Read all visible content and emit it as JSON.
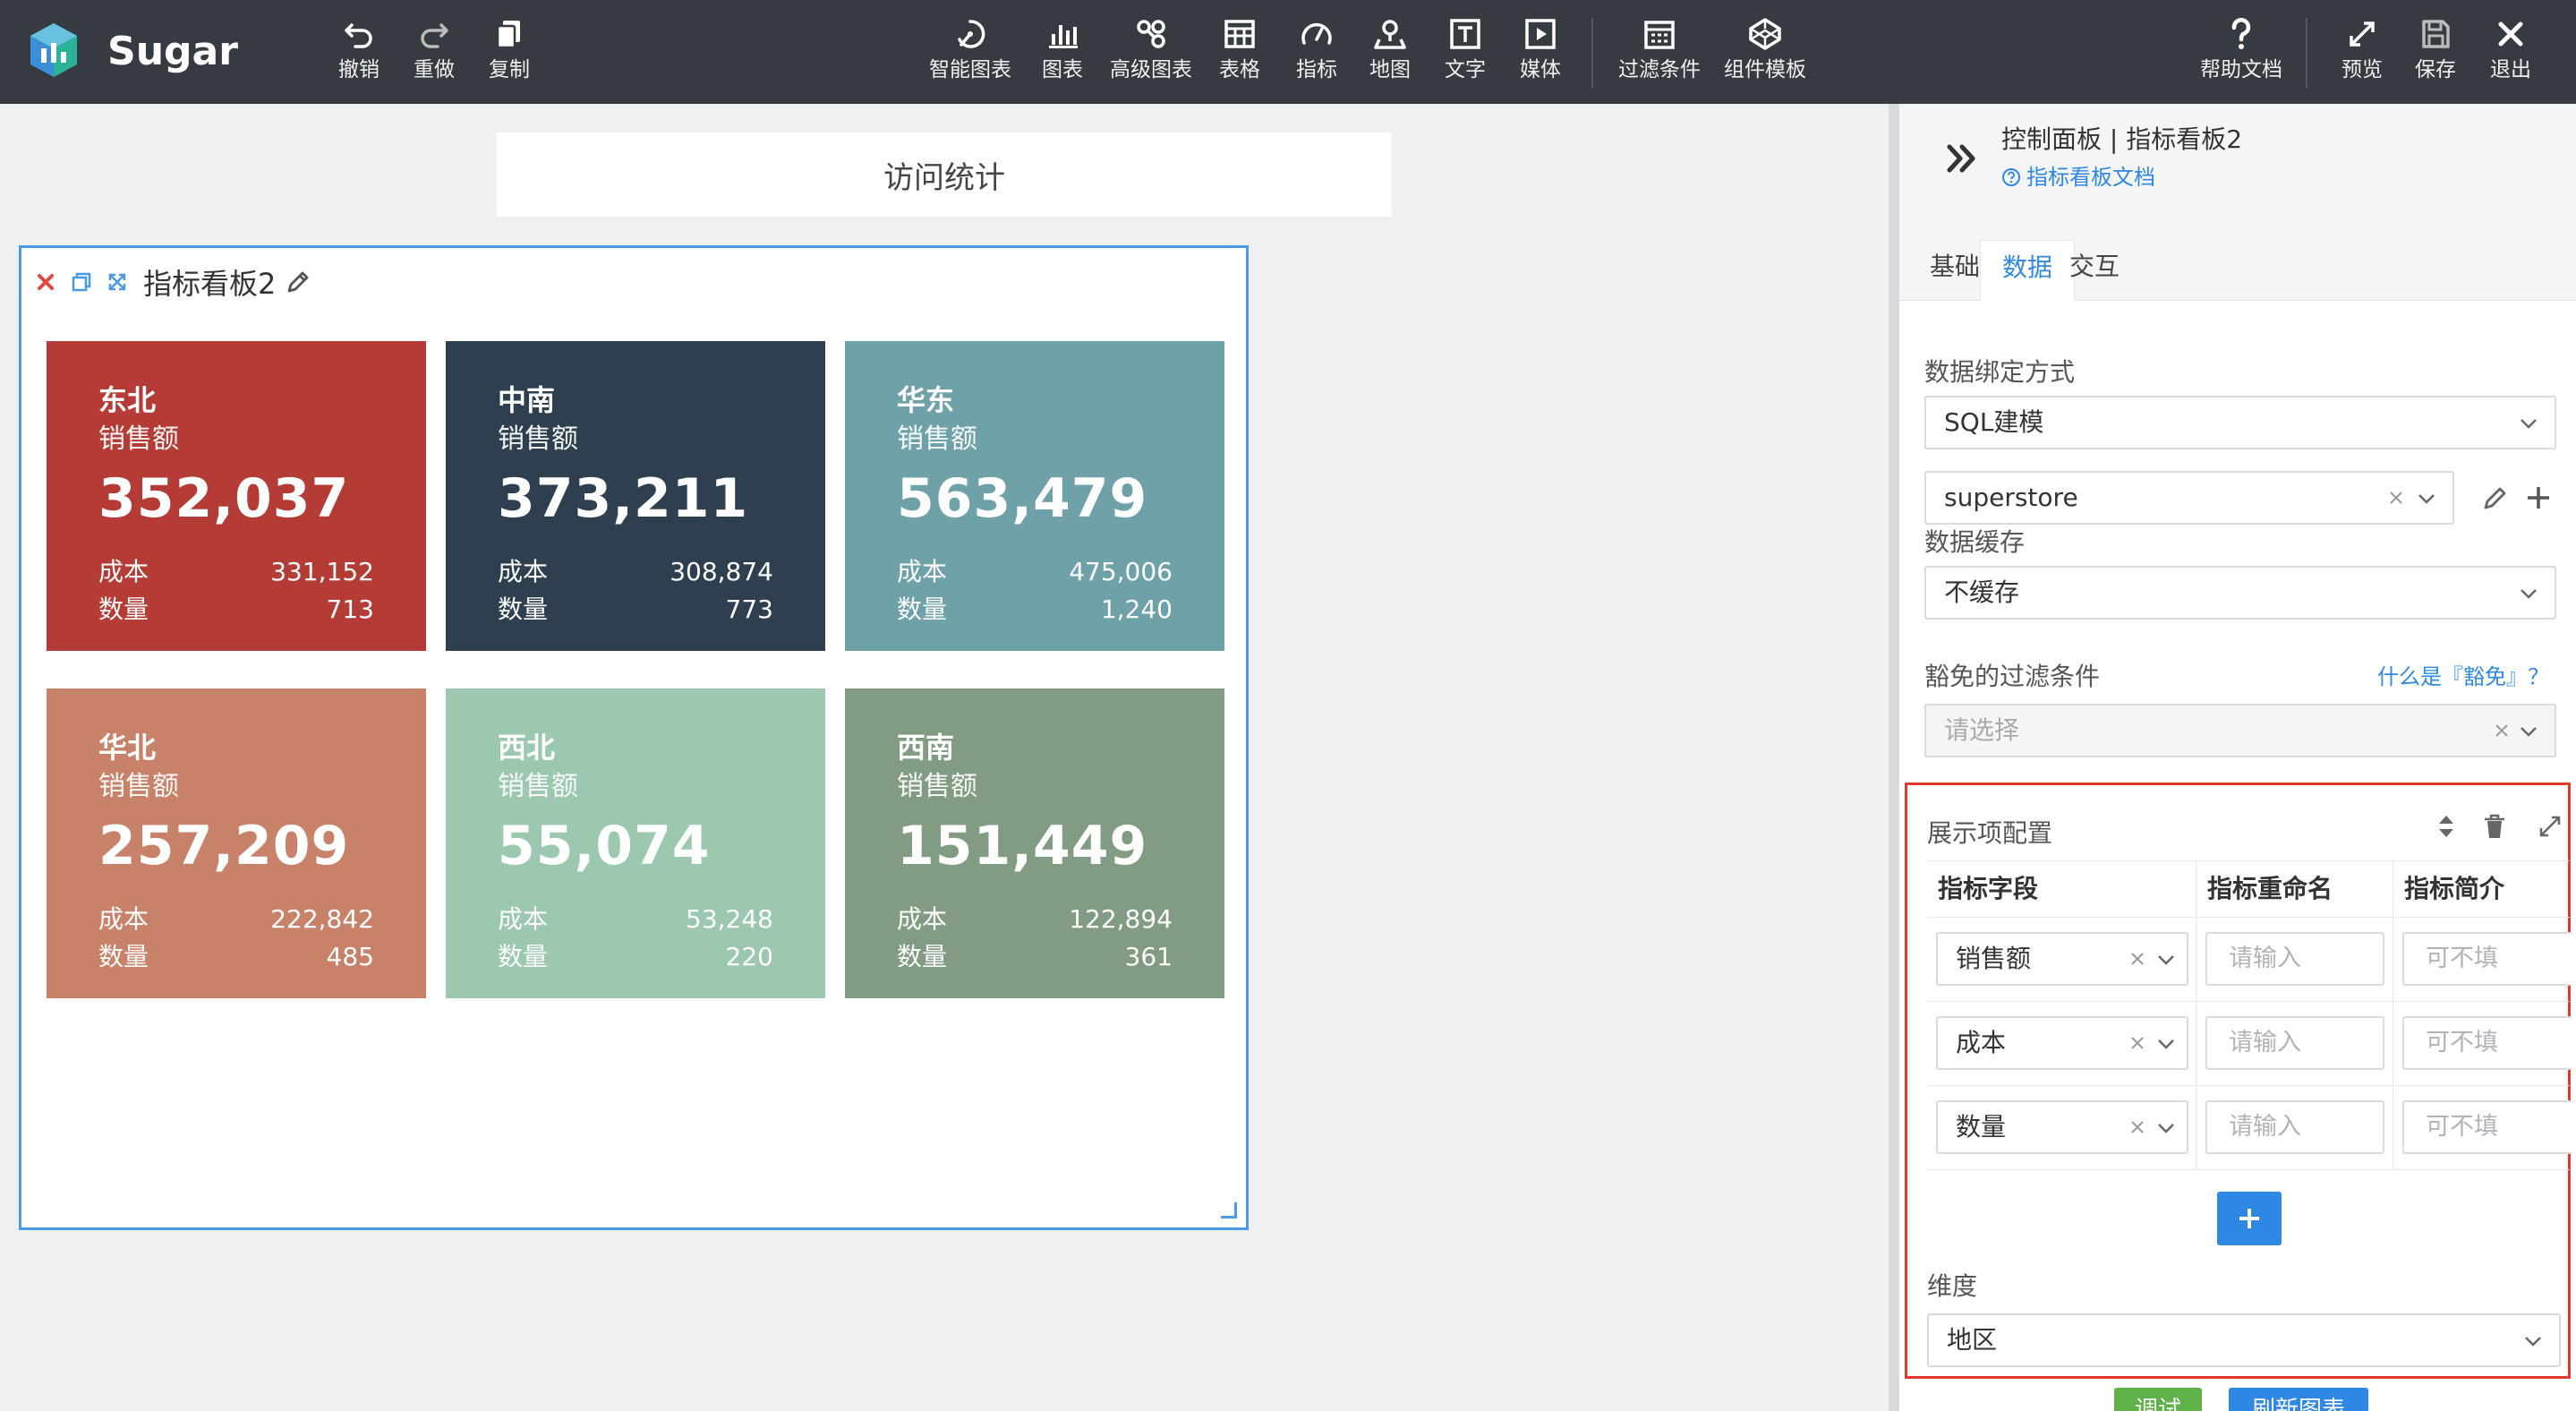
{
  "app": {
    "brand": "Sugar"
  },
  "toolbar": {
    "undo": "撤销",
    "redo": "重做",
    "copy": "复制",
    "smart_chart": "智能图表",
    "chart": "图表",
    "advanced_chart": "高级图表",
    "table": "表格",
    "indicator": "指标",
    "map": "地图",
    "text": "文字",
    "media": "媒体",
    "filter": "过滤条件",
    "component_template": "组件模板",
    "help": "帮助文档",
    "preview": "预览",
    "save": "保存",
    "exit": "退出"
  },
  "canvas": {
    "title": "访问统计",
    "widget_title": "指标看板2"
  },
  "kpis": [
    {
      "region": "东北",
      "metric_label": "销售额",
      "value": "352,037",
      "cost_label": "成本",
      "cost": "331,152",
      "qty_label": "数量",
      "qty": "713",
      "color": "#b53c36"
    },
    {
      "region": "中南",
      "metric_label": "销售额",
      "value": "373,211",
      "cost_label": "成本",
      "cost": "308,874",
      "qty_label": "数量",
      "qty": "773",
      "color": "#2e3f4f"
    },
    {
      "region": "华东",
      "metric_label": "销售额",
      "value": "563,479",
      "cost_label": "成本",
      "cost": "475,006",
      "qty_label": "数量",
      "qty": "1,240",
      "color": "#6fa1a8"
    },
    {
      "region": "华北",
      "metric_label": "销售额",
      "value": "257,209",
      "cost_label": "成本",
      "cost": "222,842",
      "qty_label": "数量",
      "qty": "485",
      "color": "#c8826a"
    },
    {
      "region": "西北",
      "metric_label": "销售额",
      "value": "55,074",
      "cost_label": "成本",
      "cost": "53,248",
      "qty_label": "数量",
      "qty": "220",
      "color": "#9cc8b0"
    },
    {
      "region": "西南",
      "metric_label": "销售额",
      "value": "151,449",
      "cost_label": "成本",
      "cost": "122,894",
      "qty_label": "数量",
      "qty": "361",
      "color": "#819c82"
    }
  ],
  "panel": {
    "breadcrumb": "控制面板 | 指标看板2",
    "doc_link": "指标看板文档",
    "tabs": [
      "基础",
      "数据",
      "交互"
    ],
    "active_tab": "数据",
    "binding_label": "数据绑定方式",
    "binding_value": "SQL建模",
    "model_value": "superstore",
    "cache_label": "数据缓存",
    "cache_value": "不缓存",
    "exempt_label": "豁免的过滤条件",
    "exempt_help": "什么是『豁免』？",
    "exempt_placeholder": "请选择",
    "config_title": "展示项配置",
    "columns": [
      "指标字段",
      "指标重命名",
      "指标简介"
    ],
    "rows": [
      {
        "field": "销售额",
        "rename_placeholder": "请输入",
        "desc_placeholder": "可不填"
      },
      {
        "field": "成本",
        "rename_placeholder": "请输入",
        "desc_placeholder": "可不填"
      },
      {
        "field": "数量",
        "rename_placeholder": "请输入",
        "desc_placeholder": "可不填"
      }
    ],
    "dimension_label": "维度",
    "dimension_value": "地区",
    "debug_btn": "调试",
    "refresh_btn": "刷新图表"
  },
  "colors": {
    "topbar": "#363b42",
    "accent": "#2f88e3",
    "selection_border": "#4a9ae8",
    "config_highlight": "#e2382e"
  }
}
